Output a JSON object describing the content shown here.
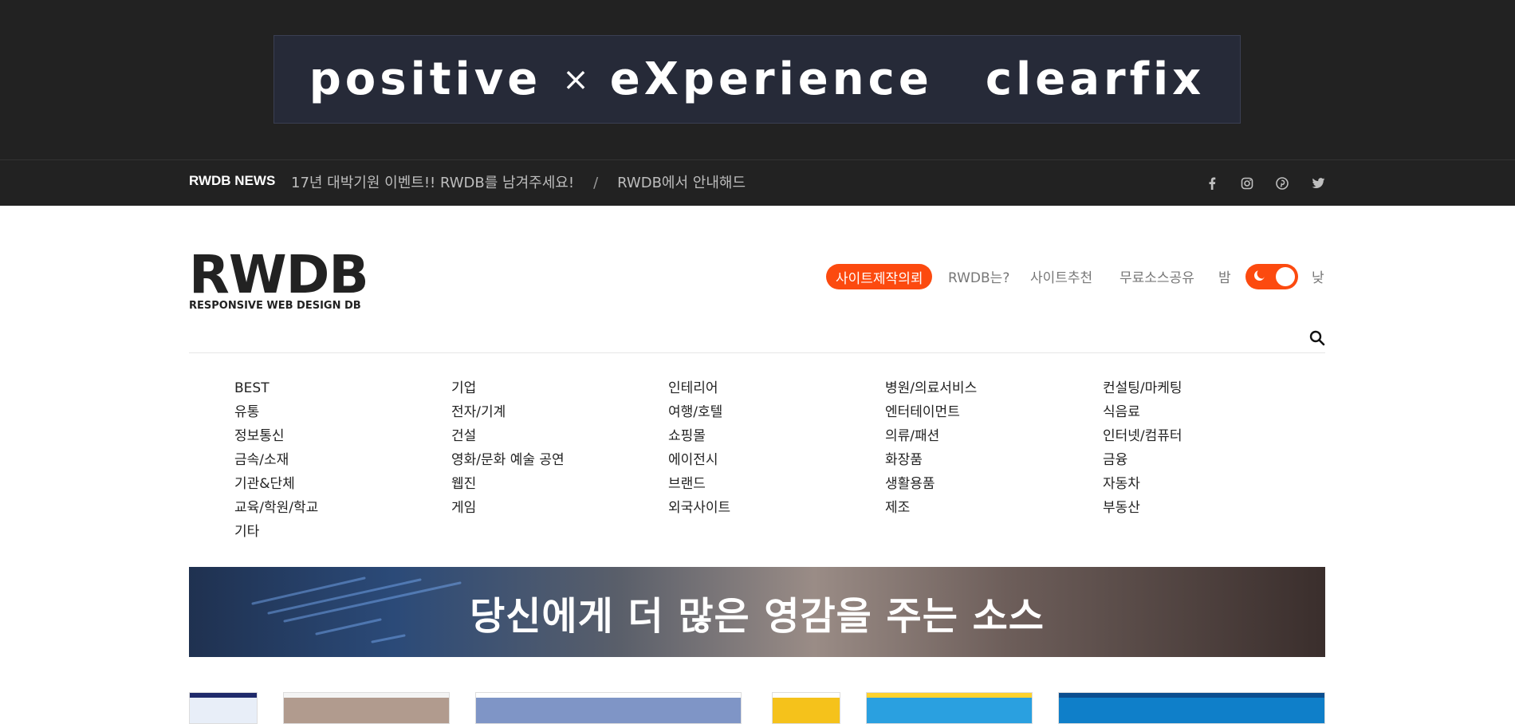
{
  "banner": {
    "word_left": "positive",
    "word_x": "×",
    "word_mid": "eXperience",
    "word_right": "clearfix"
  },
  "news": {
    "title": "RWDB NEWS",
    "items": [
      "17년 대박기원 이벤트!! RWDB를 남겨주세요!",
      "RWDB에서 안내해드리는"
    ],
    "separator": "/"
  },
  "social": {
    "icons": [
      "facebook-icon",
      "instagram-icon",
      "pinterest-icon",
      "twitter-icon"
    ]
  },
  "header": {
    "logo_main": "RWDB",
    "logo_sub": "RESPONSIVE WEB DESIGN DB",
    "nav_primary": "사이트제작의뢰",
    "nav_links": [
      "RWDB는?",
      "사이트추천",
      "무료소스공유"
    ],
    "toggle_left_label": "밤",
    "toggle_right_label": "낮"
  },
  "categories": {
    "col1": [
      "BEST",
      "유통",
      "정보통신",
      "금속/소재",
      "기관&단체",
      "교육/학원/학교",
      "기타"
    ],
    "col2": [
      "기업",
      "전자/기계",
      "건설",
      "영화/문화 예술 공연",
      "웹진",
      "게임"
    ],
    "col3": [
      "인테리어",
      "여행/호텔",
      "쇼핑몰",
      "에이전시",
      "브랜드",
      "외국사이트"
    ],
    "col4": [
      "병원/의료서비스",
      "엔터테이먼트",
      "의류/패션",
      "화장품",
      "생활용품",
      "제조"
    ],
    "col5": [
      "컨설팅/마케팅",
      "식음료",
      "인터넷/컴퓨터",
      "금융",
      "자동차",
      "부동산"
    ]
  },
  "hero": {
    "text": "당신에게 더 많은 영감을 주는 소스"
  },
  "colors": {
    "accent": "#fc4a0f",
    "dark_bg": "#222222"
  }
}
